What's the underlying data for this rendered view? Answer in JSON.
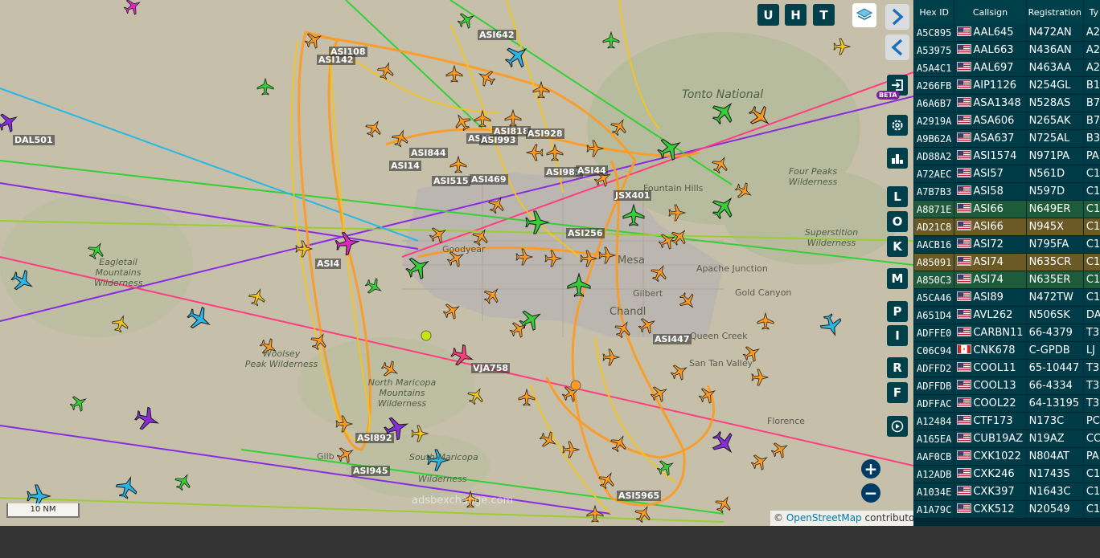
{
  "map": {
    "attribution_prefix": "©",
    "attribution_link": "OpenStreetMap",
    "attribution_suffix": "contributors.",
    "scale": "10 NM",
    "watermark": "adsbexchange.com",
    "beta_badge": "BETA",
    "places": [
      {
        "name": "Tonto National",
        "cls": "italic"
      },
      {
        "name": "Four Peaks\nWilderness",
        "cls": "italic"
      },
      {
        "name": "Fountain Hills",
        "cls": ""
      },
      {
        "name": "Superstition\nWilderness",
        "cls": "italic"
      },
      {
        "name": "Eagletail\nMountains\nWilderness",
        "cls": "italic"
      },
      {
        "name": "Goodyear",
        "cls": ""
      },
      {
        "name": "Mesa",
        "cls": ""
      },
      {
        "name": "Apache Junction",
        "cls": ""
      },
      {
        "name": "Gilbert",
        "cls": ""
      },
      {
        "name": "Gold Canyon",
        "cls": ""
      },
      {
        "name": "Chandl",
        "cls": ""
      },
      {
        "name": "Queen Creek",
        "cls": ""
      },
      {
        "name": "San Tan Valley",
        "cls": ""
      },
      {
        "name": "Woolsey\nPeak Wilderness",
        "cls": "italic"
      },
      {
        "name": "North Maricopa\nMountains\nWilderness",
        "cls": "italic"
      },
      {
        "name": "South Maricopa",
        "cls": "italic"
      },
      {
        "name": "Wilderness",
        "cls": "italic"
      },
      {
        "name": "Florence",
        "cls": ""
      },
      {
        "name": "Gilb",
        "cls": ""
      }
    ],
    "callsigns": [
      "ASI642",
      "ASI108",
      "ASI142",
      "DAL501",
      "ASI844",
      "ASI14",
      "ASI8",
      "ASI818",
      "ASI993",
      "ASI928",
      "ASI515",
      "ASI469",
      "ASI985",
      "ASI44",
      "JSX401",
      "ASI256",
      "ASI4",
      "ASI447",
      "VJA758",
      "ASI892",
      "ASI945",
      "ASI5965"
    ]
  },
  "buttons": {
    "u": "U",
    "h": "H",
    "t": "T",
    "l": "L",
    "o": "O",
    "k": "K",
    "m": "M",
    "p": "P",
    "i": "I",
    "r": "R",
    "f": "F",
    "zoom_in": "+",
    "zoom_out": "−"
  },
  "colors": {
    "orange": "#ff9a1f",
    "yellow": "#f5c518",
    "green": "#35d035",
    "cyan": "#29b6e6",
    "magenta": "#e026c8",
    "purple": "#8a2be2",
    "pink": "#ff3d7f",
    "table_bg": "#003b48"
  },
  "table": {
    "headers": [
      "Hex ID",
      "Callsign",
      "Registration",
      "Ty"
    ],
    "rows": [
      {
        "hex": "A5C895",
        "flag": "us",
        "callsign": "AAL645",
        "reg": "N472AN",
        "type": "A2",
        "cls": "row"
      },
      {
        "hex": "A53975",
        "flag": "us",
        "callsign": "AAL663",
        "reg": "N436AN",
        "type": "A2",
        "cls": "row"
      },
      {
        "hex": "A5A4C1",
        "flag": "us",
        "callsign": "AAL697",
        "reg": "N463AA",
        "type": "A2",
        "cls": "row"
      },
      {
        "hex": "A266FB",
        "flag": "us",
        "callsign": "AIP1126",
        "reg": "N254GL",
        "type": "B1",
        "cls": "row"
      },
      {
        "hex": "A6A6B7",
        "flag": "us",
        "callsign": "ASA1348",
        "reg": "N528AS",
        "type": "B7",
        "cls": "row"
      },
      {
        "hex": "A2919A",
        "flag": "us",
        "callsign": "ASA606",
        "reg": "N265AK",
        "type": "B7",
        "cls": "row"
      },
      {
        "hex": "A9B62A",
        "flag": "us",
        "callsign": "ASA637",
        "reg": "N725AL",
        "type": "B3",
        "cls": "row"
      },
      {
        "hex": "AD88A2",
        "flag": "us",
        "callsign": "ASI1574",
        "reg": "N971PA",
        "type": "PA",
        "cls": "row"
      },
      {
        "hex": "A72AEC",
        "flag": "us",
        "callsign": "ASI57",
        "reg": "N561D",
        "type": "C1",
        "cls": "row"
      },
      {
        "hex": "A7B7B3",
        "flag": "us",
        "callsign": "ASI58",
        "reg": "N597D",
        "type": "C1",
        "cls": "row"
      },
      {
        "hex": "A8871E",
        "flag": "us",
        "callsign": "ASI66",
        "reg": "N649ER",
        "type": "C1",
        "cls": "green"
      },
      {
        "hex": "AD21C8",
        "flag": "us",
        "callsign": "ASI66",
        "reg": "N945X",
        "type": "C1",
        "cls": "olive"
      },
      {
        "hex": "AACB16",
        "flag": "us",
        "callsign": "ASI72",
        "reg": "N795FA",
        "type": "C1",
        "cls": "row"
      },
      {
        "hex": "A85091",
        "flag": "us",
        "callsign": "ASI74",
        "reg": "N635CR",
        "type": "C1",
        "cls": "olive"
      },
      {
        "hex": "A850C3",
        "flag": "us",
        "callsign": "ASI74",
        "reg": "N635ER",
        "type": "C1",
        "cls": "green"
      },
      {
        "hex": "A5CA46",
        "flag": "us",
        "callsign": "ASI89",
        "reg": "N472TW",
        "type": "C1",
        "cls": "row"
      },
      {
        "hex": "A651D4",
        "flag": "us",
        "callsign": "AVL262",
        "reg": "N506SK",
        "type": "DA",
        "cls": "row"
      },
      {
        "hex": "ADFFE0",
        "flag": "us",
        "callsign": "CARBN11",
        "reg": "66-4379",
        "type": "T3",
        "cls": "row"
      },
      {
        "hex": "C06C94",
        "flag": "ca",
        "callsign": "CNK678",
        "reg": "C-GPDB",
        "type": "LJ",
        "cls": "row"
      },
      {
        "hex": "ADFFD2",
        "flag": "us",
        "callsign": "COOL11",
        "reg": "65-10447",
        "type": "T3",
        "cls": "row"
      },
      {
        "hex": "ADFFDB",
        "flag": "us",
        "callsign": "COOL13",
        "reg": "66-4334",
        "type": "T3",
        "cls": "row"
      },
      {
        "hex": "ADFFAC",
        "flag": "us",
        "callsign": "COOL22",
        "reg": "64-13195",
        "type": "T3",
        "cls": "row"
      },
      {
        "hex": "A12484",
        "flag": "us",
        "callsign": "CTF173",
        "reg": "N173C",
        "type": "PC",
        "cls": "row"
      },
      {
        "hex": "A165EA",
        "flag": "us",
        "callsign": "CUB19AZ",
        "reg": "N19AZ",
        "type": "CC",
        "cls": "row"
      },
      {
        "hex": "AAF0CB",
        "flag": "us",
        "callsign": "CXK1022",
        "reg": "N804AT",
        "type": "PA",
        "cls": "row"
      },
      {
        "hex": "A12ADB",
        "flag": "us",
        "callsign": "CXK246",
        "reg": "N1743S",
        "type": "C1",
        "cls": "row"
      },
      {
        "hex": "A1034E",
        "flag": "us",
        "callsign": "CXK397",
        "reg": "N1643C",
        "type": "C1",
        "cls": "row"
      },
      {
        "hex": "A1A79C",
        "flag": "us",
        "callsign": "CXK512",
        "reg": "N20549",
        "type": "C1",
        "cls": "row"
      }
    ]
  }
}
